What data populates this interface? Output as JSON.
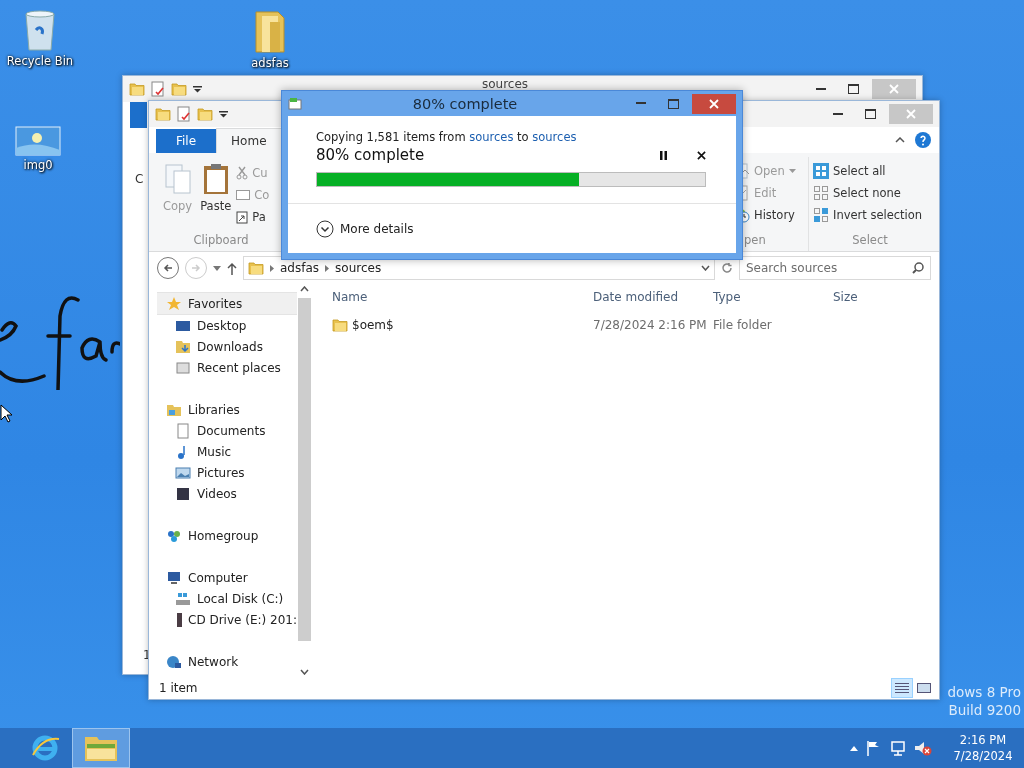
{
  "desktop": {
    "icons": [
      {
        "label": "Recycle Bin",
        "kind": "bin"
      },
      {
        "label": "adsfas",
        "kind": "folder"
      },
      {
        "label": "img0",
        "kind": "image"
      }
    ],
    "watermark": [
      "dows 8 Pro",
      "Build 9200"
    ]
  },
  "back_window": {
    "title": "sources",
    "fragments": [
      "C",
      "1"
    ]
  },
  "explorer": {
    "tabs": [
      {
        "label": "File",
        "kind": "file",
        "selected": false
      },
      {
        "label": "Home",
        "kind": "tab",
        "selected": true
      }
    ],
    "clipboard": {
      "big": [
        {
          "label": "Copy",
          "kind": "copy",
          "disabled": true
        },
        {
          "label": "Paste",
          "kind": "paste",
          "disabled": false
        }
      ],
      "small": [
        {
          "label": "Cu",
          "kind": "cut"
        },
        {
          "label": "Co",
          "kind": "copypath"
        },
        {
          "label": "Pa",
          "kind": "shortcut"
        }
      ],
      "label": "Clipboard"
    },
    "open_group": {
      "items": [
        {
          "label": "Open",
          "kind": "open",
          "disabled": true,
          "dropdown": true
        },
        {
          "label": "Edit",
          "kind": "edit",
          "disabled": true,
          "dropdown": false
        },
        {
          "label": "History",
          "kind": "history",
          "disabled": false,
          "dropdown": false
        }
      ],
      "label": "pen"
    },
    "select_group": {
      "items": [
        {
          "label": "Select all",
          "kind": "all"
        },
        {
          "label": "Select none",
          "kind": "none"
        },
        {
          "label": "Invert selection",
          "kind": "invert"
        }
      ],
      "label": "Select"
    },
    "path": [
      "adsfas",
      "sources"
    ],
    "search": {
      "placeholder": "Search sources"
    },
    "nav": [
      {
        "label": "Favorites",
        "kind": "star",
        "selected": true,
        "children": [
          {
            "label": "Desktop",
            "kind": "desktop",
            "selected": false
          },
          {
            "label": "Downloads",
            "kind": "downloads",
            "selected": false
          },
          {
            "label": "Recent places",
            "kind": "recent",
            "selected": false
          }
        ]
      },
      {
        "label": "Libraries",
        "kind": "library",
        "selected": false,
        "children": [
          {
            "label": "Documents",
            "kind": "documents",
            "selected": false
          },
          {
            "label": "Music",
            "kind": "music",
            "selected": false
          },
          {
            "label": "Pictures",
            "kind": "pictures",
            "selected": false
          },
          {
            "label": "Videos",
            "kind": "videos",
            "selected": false
          }
        ]
      },
      {
        "label": "Homegroup",
        "kind": "homegroup",
        "selected": false
      },
      {
        "label": "Computer",
        "kind": "computer",
        "selected": false,
        "children": [
          {
            "label": "Local Disk (C:)",
            "kind": "disk",
            "selected": false
          },
          {
            "label": "CD Drive (E:) 201:",
            "kind": "cd",
            "selected": false
          }
        ]
      },
      {
        "label": "Network",
        "kind": "network",
        "selected": false
      }
    ],
    "columns": [
      "Name",
      "Date modified",
      "Type",
      "Size"
    ],
    "rows": [
      {
        "name": "$oem$",
        "date": "7/28/2024 2:16 PM",
        "type": "File folder"
      }
    ],
    "status": "1 item",
    "views": [
      {
        "kind": "details",
        "selected": true
      },
      {
        "kind": "preview",
        "selected": false
      }
    ]
  },
  "dialog": {
    "title": "80% complete",
    "message": [
      {
        "text": "Copying 1,581 items from ",
        "link": false
      },
      {
        "text": "sources",
        "link": true
      },
      {
        "text": " to ",
        "link": false
      },
      {
        "text": "sources",
        "link": true
      }
    ],
    "progress_text": "80% complete",
    "level": 0.674,
    "details": "More details"
  },
  "taskbar": {
    "apps": [
      {
        "kind": "ie",
        "selected": false
      },
      {
        "kind": "explorer",
        "selected": true
      }
    ],
    "time": "2:16 PM",
    "date": "7/28/2024",
    "volume_muted": true
  }
}
